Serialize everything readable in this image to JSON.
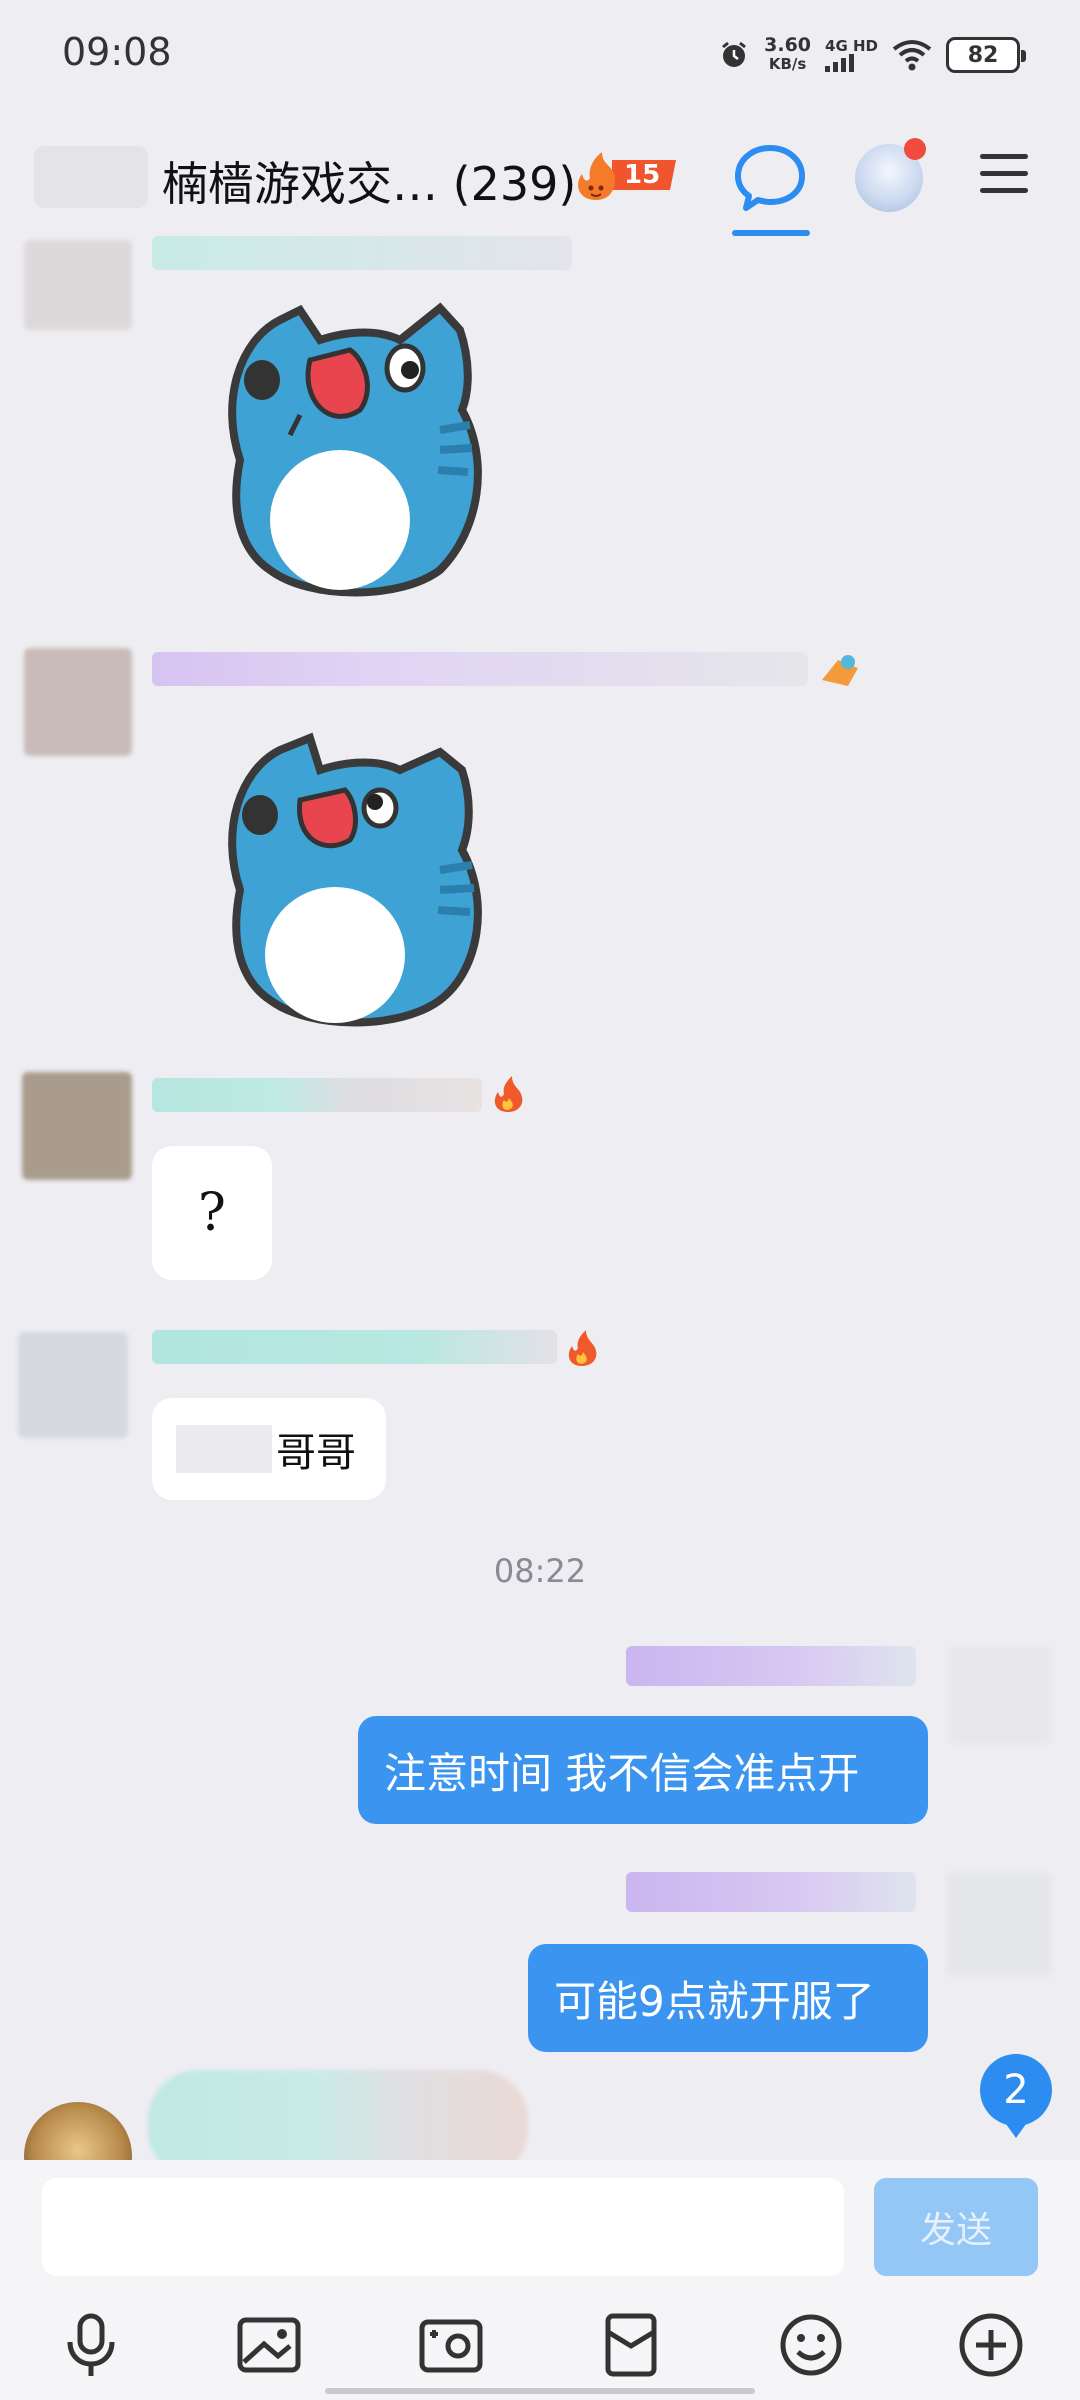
{
  "status_bar": {
    "time": "09:08",
    "net_speed_value": "3.60",
    "net_speed_unit": "KB/s",
    "network_label": "4G HD",
    "battery": "82"
  },
  "header": {
    "group_title": "楠樯游戏交… (239)",
    "fire_level": "15"
  },
  "messages": {
    "m3_text": "?",
    "m4_text": "哥哥",
    "time_separator": "08:22",
    "sent_1": "注意时间 我不信会准点开",
    "sent_2": "可能9点就开服了"
  },
  "unread_count": "2",
  "input": {
    "placeholder": "",
    "send_label": "发送"
  },
  "toolbar": {
    "icons": [
      "microphone-icon",
      "image-icon",
      "camera-icon",
      "red-packet-icon",
      "emoji-icon",
      "plus-icon"
    ]
  },
  "colors": {
    "accent": "#2d8cf0",
    "sent_bubble": "#3b95f0",
    "background": "#eeedf2"
  }
}
